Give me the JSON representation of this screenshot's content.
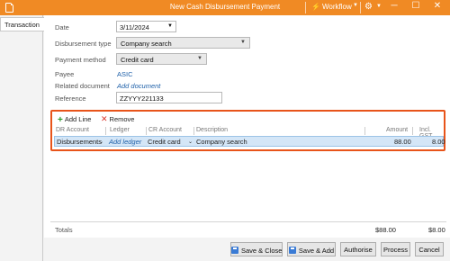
{
  "window": {
    "title": "New Cash Disbursement Payment",
    "workflow_label": "Workflow",
    "minimize": "─",
    "maximize": "☐",
    "close": "✕"
  },
  "tabs": [
    {
      "label": "Transaction"
    }
  ],
  "form": {
    "date_label": "Date",
    "date_value": "3/11/2024",
    "disbursement_type_label": "Disbursement type",
    "disbursement_type_value": "Company search",
    "payment_method_label": "Payment method",
    "payment_method_value": "Credit card",
    "payee_label": "Payee",
    "payee_value": "ASIC",
    "related_document_label": "Related document",
    "related_document_value": "Add document",
    "reference_label": "Reference",
    "reference_value": "ZZYYY221133"
  },
  "grid": {
    "add_line_label": "Add Line",
    "remove_label": "Remove",
    "columns": [
      "DR Account",
      "Ledger",
      "CR Account",
      "Description",
      "Amount",
      "Incl. GST"
    ],
    "rows": [
      {
        "dr_account": "Disbursements",
        "ledger": "Add ledger",
        "cr_account": "Credit card",
        "description": "Company search",
        "amount": "88.00",
        "incl_gst": "8.00"
      }
    ]
  },
  "totals": {
    "label": "Totals",
    "amount": "$88.00",
    "gst": "$8.00"
  },
  "buttons": {
    "save_close": "Save & Close",
    "save_add": "Save & Add",
    "authorise": "Authorise",
    "process": "Process",
    "cancel": "Cancel"
  },
  "colors": {
    "titlebar": "#f08a24",
    "grid_highlight_border": "#e8541a",
    "selected_row": "#d4e6f7",
    "link": "#1d5fa8"
  }
}
